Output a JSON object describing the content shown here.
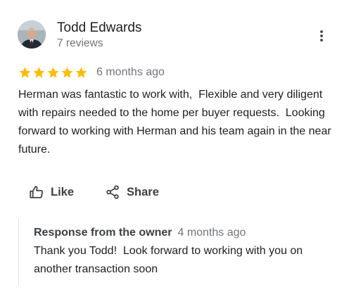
{
  "reviewer": {
    "name": "Todd Edwards",
    "review_count": "7 reviews"
  },
  "rating": {
    "stars": 5,
    "max_stars": 5,
    "star_color": "#fbbc04",
    "date": "6 months ago"
  },
  "review": {
    "text": "Herman was fantastic to work with,  Flexible and very diligent with repairs needed to the home per buyer requests.  Looking forward to working with Herman and his team again in the near future."
  },
  "actions": {
    "like_label": "Like",
    "share_label": "Share",
    "like_icon": "thumb-up-icon",
    "share_icon": "share-icon",
    "more_icon": "more-vert-icon"
  },
  "owner_response": {
    "title": "Response from the owner",
    "date": "4 months ago",
    "text": "Thank you Todd!  Look forward to working with you on another transaction soon"
  },
  "colors": {
    "primary_text": "#202124",
    "secondary_text": "#70757a",
    "action_text": "#3c4043",
    "divider": "#e3e3e3"
  }
}
